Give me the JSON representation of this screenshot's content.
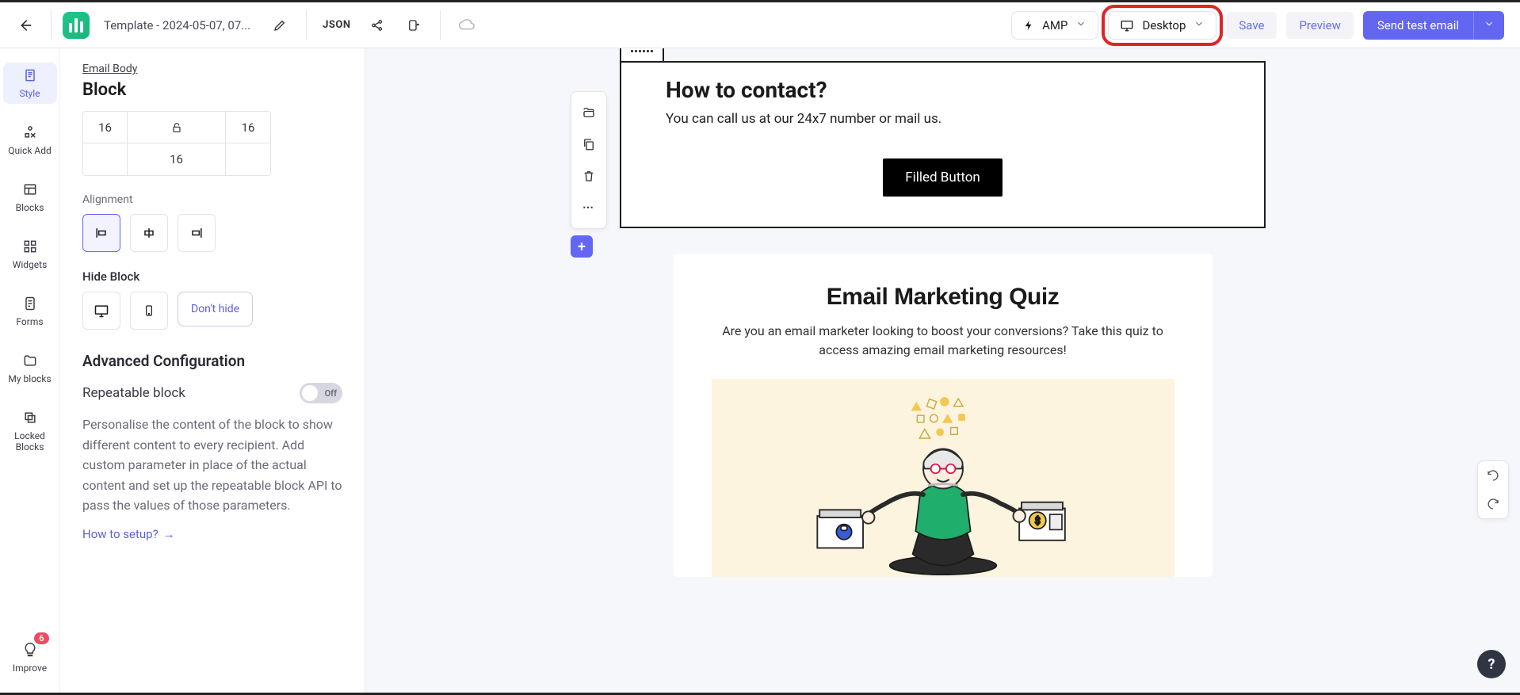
{
  "topbar": {
    "template_name": "Template - 2024-05-07, 07...",
    "json_label": "JSON",
    "amp_label": "AMP",
    "viewport_label": "Desktop",
    "save_label": "Save",
    "preview_label": "Preview",
    "send_label": "Send test email"
  },
  "rail": {
    "items": [
      {
        "label": "Style"
      },
      {
        "label": "Quick Add"
      },
      {
        "label": "Blocks"
      },
      {
        "label": "Widgets"
      },
      {
        "label": "Forms"
      },
      {
        "label": "My blocks"
      },
      {
        "label": "Locked Blocks"
      }
    ],
    "improve_label": "Improve",
    "improve_count": "6"
  },
  "panel": {
    "crumb": "Email Body",
    "heading": "Block",
    "padding": {
      "left": "16",
      "right": "16",
      "bottom": "16"
    },
    "alignment_label": "Alignment",
    "hide_label": "Hide Block",
    "dont_hide": "Don't hide",
    "advanced_heading": "Advanced Configuration",
    "repeatable_label": "Repeatable block",
    "repeatable_state": "Off",
    "repeatable_desc": "Personalise the content of the block to show different content to every recipient. Add custom parameter in place of the actual content and set up the repeatable block API to pass the values of those parameters.",
    "howto_label": "How to setup?"
  },
  "canvas": {
    "block1": {
      "heading": "How to contact?",
      "text": "You can call us at our 24x7 number or mail us.",
      "button": "Filled Button"
    },
    "block2": {
      "heading": "Email Marketing Quiz",
      "text": "Are you an email marketer looking to boost your conversions? Take this quiz to access amazing email marketing resources!"
    }
  }
}
